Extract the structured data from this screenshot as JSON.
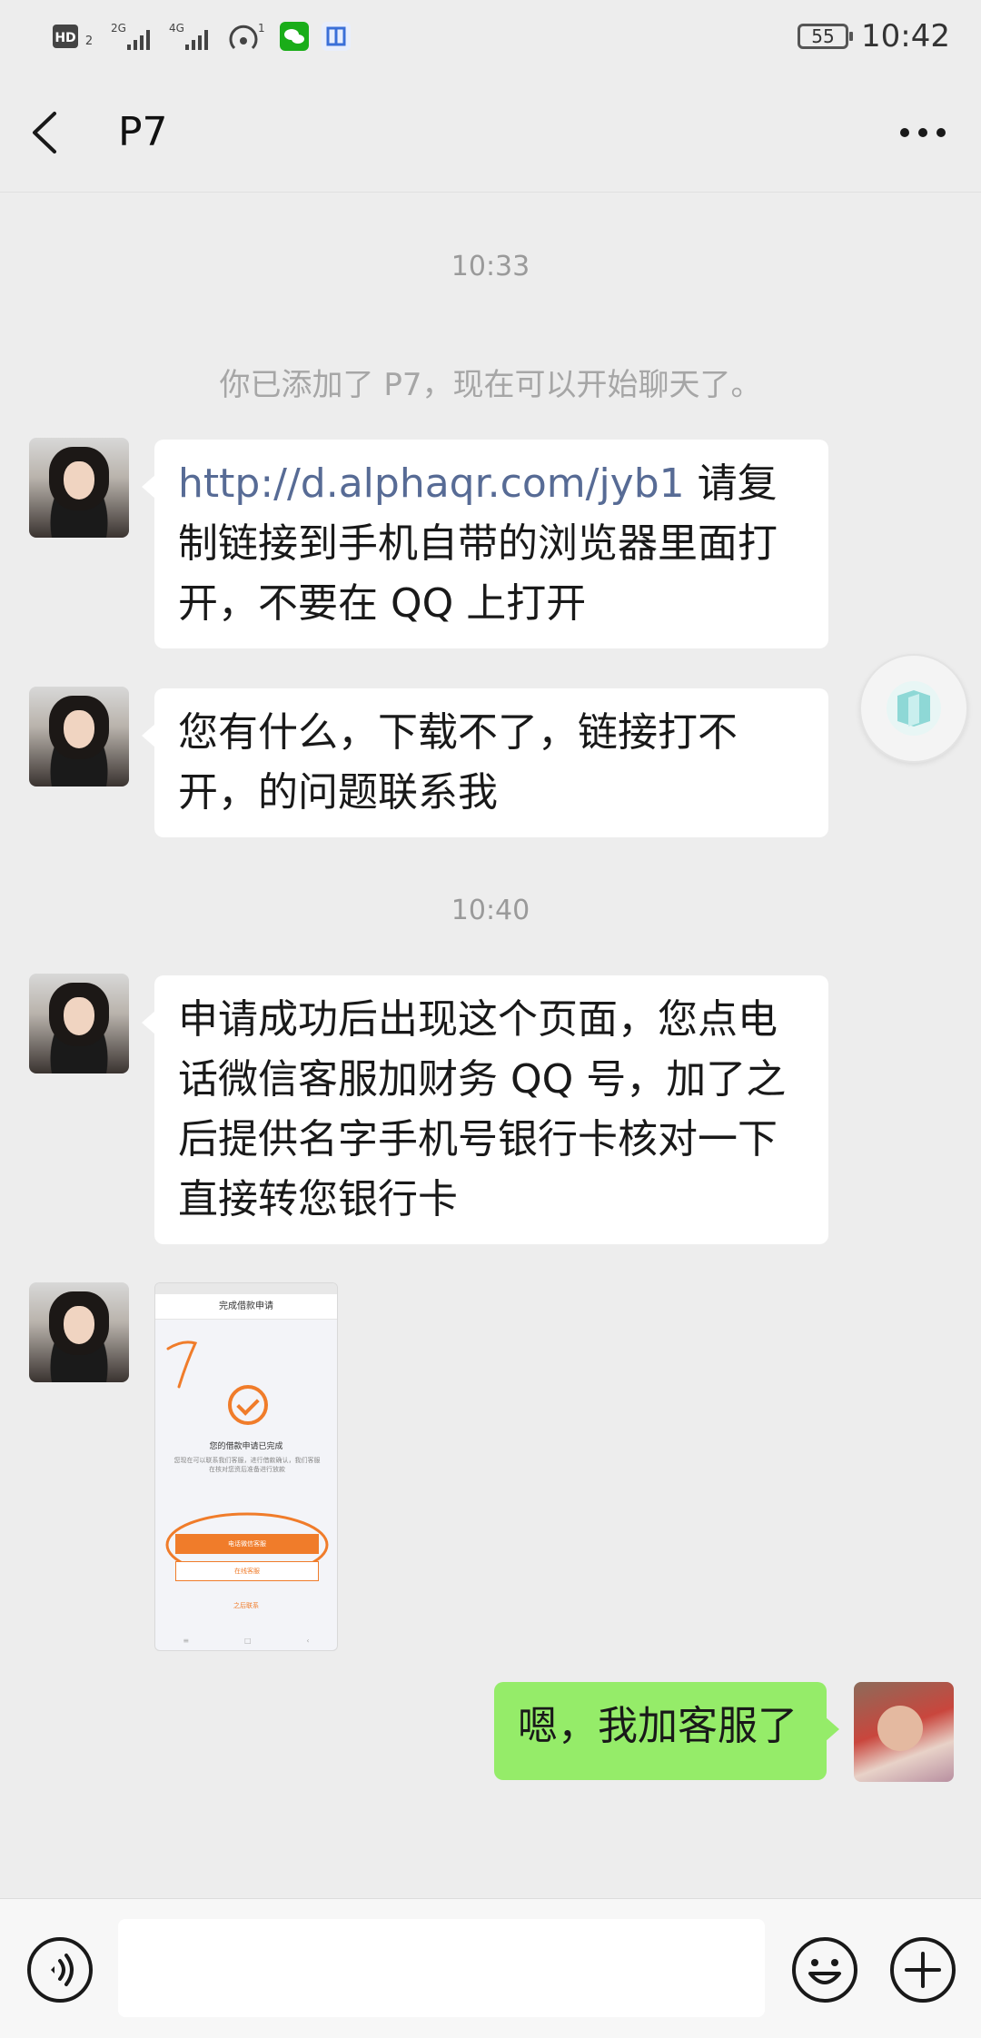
{
  "status_bar": {
    "hd_label": "HD",
    "hd_sub": "2",
    "net1": "2G",
    "net2": "4G",
    "hotspot_count": "1",
    "battery": "55",
    "time": "10:42"
  },
  "header": {
    "title": "P7"
  },
  "chat": {
    "timestamp1": "10:33",
    "system_message": "你已添加了 P7，现在可以开始聊天了。",
    "msg1_link": "http://d.alphaqr.com/jyb1",
    "msg1_text": " 请复制链接到手机自带的浏览器里面打开，不要在 QQ 上打开",
    "msg2_text": "您有什么，下载不了，链接打不开，的问题联系我",
    "timestamp2": "10:40",
    "msg3_text": "申请成功后出现这个页面，您点电话微信客服加财务 QQ 号，加了之后提供名字手机号银行卡核对一下直接转您银行卡",
    "msg5_text": "嗯，我加客服了"
  },
  "screenshot_image": {
    "header": "完成借款申请",
    "title": "您的借款申请已完成",
    "description": "您现在可以联系我们客服，进行借款确认，我们客服在核对您资后准备进行放款",
    "button_primary": "电话微信客服",
    "button_secondary": "在线客服",
    "footer_link": "之后联系"
  },
  "icons": {
    "back": "back-arrow-icon",
    "more": "more-dots-icon",
    "voice": "voice-icon",
    "emoji": "emoji-icon",
    "plus": "plus-icon",
    "floating": "floating-window-icon"
  },
  "colors": {
    "background": "#ededed",
    "bubble_incoming": "#ffffff",
    "bubble_outgoing": "#95ec69",
    "link": "#576b95",
    "accent_orange": "#f07c2a"
  }
}
